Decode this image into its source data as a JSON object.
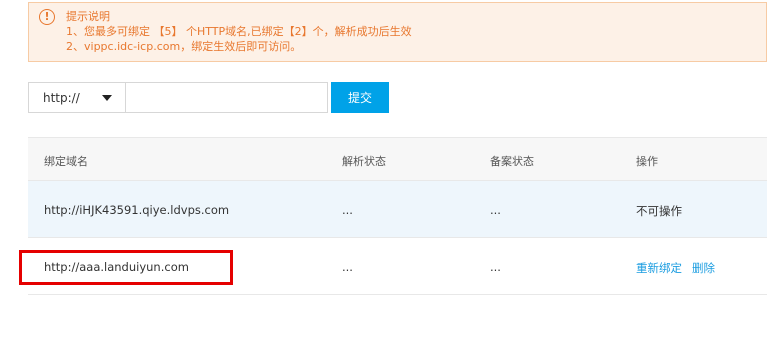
{
  "notice": {
    "icon": "exclamation-circle-icon",
    "title": "提示说明",
    "line1": "1、您最多可绑定 【5】 个HTTP域名,已绑定【2】个，解析成功后生效",
    "line2": "2、vippc.idc-icp.com，绑定生效后即可访问。"
  },
  "form": {
    "protocol_selected": "http://",
    "domain_value": "",
    "submit_label": "提交"
  },
  "table": {
    "headers": [
      "绑定域名",
      "解析状态",
      "备案状态",
      "操作"
    ],
    "rows": [
      {
        "domain": "http://iHJK43591.qiye.ldvps.com",
        "dns_status": "...",
        "icp_status": "...",
        "action": "不可操作"
      },
      {
        "domain": "http://aaa.landuiyun.com",
        "dns_status": "...",
        "icp_status": "...",
        "action_rebind": "重新绑定",
        "action_delete": "删除"
      }
    ]
  },
  "colors": {
    "notice_text": "#e8772e",
    "notice_bg": "#fdf1e7",
    "primary_button": "#00a2e8",
    "link": "#1a9ce0",
    "highlight_box": "#e50000"
  }
}
